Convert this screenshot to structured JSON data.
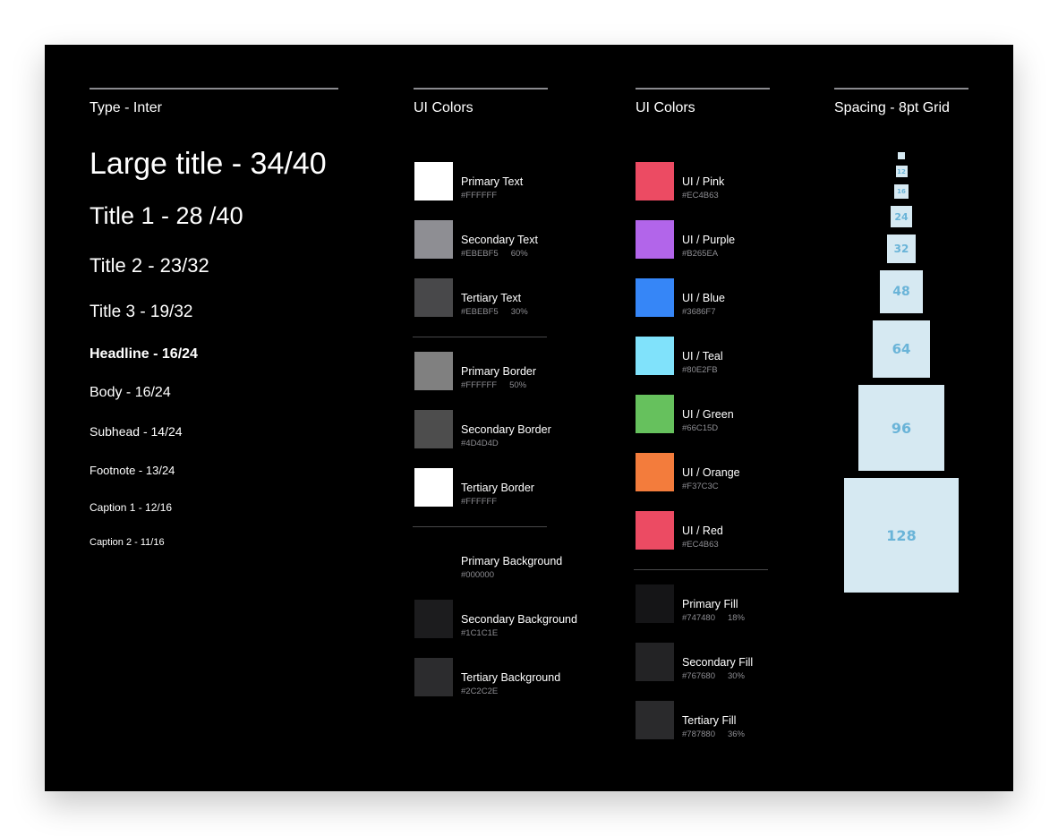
{
  "columns": {
    "type": {
      "header": "Type - Inter"
    },
    "ui_colors_1": {
      "header": "UI Colors"
    },
    "ui_colors_2": {
      "header": "UI Colors"
    },
    "spacing": {
      "header": "Spacing - 8pt Grid"
    }
  },
  "type_samples": [
    "Large title - 34/40",
    "Title 1 - 28 /40",
    "Title 2 - 23/32",
    "Title 3 - 19/32",
    "Headline - 16/24",
    "Body - 16/24",
    "Subhead - 14/24",
    "Footnote - 13/24",
    "Caption 1 - 12/16",
    "Caption 2 - 11/16"
  ],
  "label_colors": [
    {
      "name": "Primary Text",
      "hex": "#FFFFFF",
      "pct": "",
      "swatch": "#FFFFFF"
    },
    {
      "name": "Secondary Text",
      "hex": "#EBEBF5",
      "pct": "60%",
      "swatch": "#8E8E93"
    },
    {
      "name": "Tertiary Text",
      "hex": "#EBEBF5",
      "pct": "30%",
      "swatch": "#48484A"
    }
  ],
  "border_colors": [
    {
      "name": "Primary Border",
      "hex": "#FFFFFF",
      "pct": "50%",
      "swatch": "#808080"
    },
    {
      "name": "Secondary Border",
      "hex": "#4D4D4D",
      "pct": "",
      "swatch": "#4D4D4D"
    },
    {
      "name": "Tertiary Border",
      "hex": "#FFFFFF",
      "pct": "",
      "swatch": "#FFFFFF"
    }
  ],
  "background_colors": [
    {
      "name": "Primary Background",
      "hex": "#000000",
      "pct": "",
      "swatch": "#000000"
    },
    {
      "name": "Secondary Background",
      "hex": "#1C1C1E",
      "pct": "",
      "swatch": "#1C1C1E"
    },
    {
      "name": "Tertiary Background",
      "hex": "#2C2C2E",
      "pct": "",
      "swatch": "#2C2C2E"
    }
  ],
  "ui_colors": [
    {
      "name": "UI / Pink",
      "hex": "#EC4B63",
      "pct": "",
      "swatch": "#EC4B63"
    },
    {
      "name": "UI / Purple",
      "hex": "#B265EA",
      "pct": "",
      "swatch": "#B265EA"
    },
    {
      "name": "UI / Blue",
      "hex": "#3686F7",
      "pct": "",
      "swatch": "#3686F7"
    },
    {
      "name": "UI / Teal",
      "hex": "#80E2FB",
      "pct": "",
      "swatch": "#80E2FB"
    },
    {
      "name": "UI / Green",
      "hex": "#66C15D",
      "pct": "",
      "swatch": "#66C15D"
    },
    {
      "name": "UI / Orange",
      "hex": "#F37C3C",
      "pct": "",
      "swatch": "#F37C3C"
    },
    {
      "name": "UI / Red",
      "hex": "#EC4B63",
      "pct": "",
      "swatch": "#EC4B63"
    }
  ],
  "fill_colors": [
    {
      "name": "Primary Fill",
      "hex": "#747480",
      "pct": "18%",
      "swatch": "#151517"
    },
    {
      "name": "Secondary Fill",
      "hex": "#767680",
      "pct": "30%",
      "swatch": "#232325"
    },
    {
      "name": "Tertiary Fill",
      "hex": "#787880",
      "pct": "36%",
      "swatch": "#2a2a2c"
    }
  ],
  "spacing": [
    "",
    "12",
    "16",
    "24",
    "32",
    "48",
    "64",
    "96",
    "128"
  ]
}
